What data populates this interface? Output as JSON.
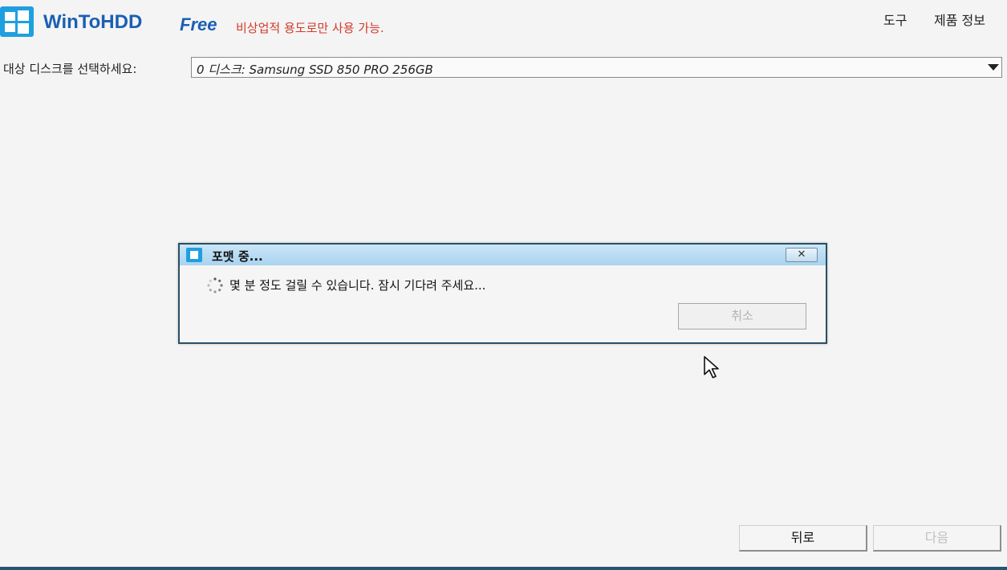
{
  "app": {
    "name": "WinToHDD",
    "edition": "Free",
    "license_note": "비상업적 용도로만 사용 가능."
  },
  "menu": {
    "tools": "도구",
    "about": "제품 정보"
  },
  "disk_select": {
    "label": "대상 디스크를 선택하세요:",
    "value": "0 디스크: Samsung SSD 850 PRO 256GB"
  },
  "dialog": {
    "title": "포맷 중...",
    "close_glyph": "✕",
    "message": "몇 분 정도 걸릴 수 있습니다. 잠시 기다려 주세요...",
    "cancel_label": "취소"
  },
  "nav": {
    "back_label": "뒤로",
    "next_label": "다음"
  },
  "colors": {
    "brand": "#1a5fb4",
    "logo": "#1f9fe0",
    "license_note": "#d23a2a",
    "dialog_title_bg": "#b9dcf2",
    "disabled_text": "#b3b3b3"
  },
  "icons": [
    "windows-logo-icon",
    "format-icon",
    "close-icon",
    "spinner-icon",
    "dropdown-arrow-icon",
    "mouse-cursor-icon"
  ]
}
